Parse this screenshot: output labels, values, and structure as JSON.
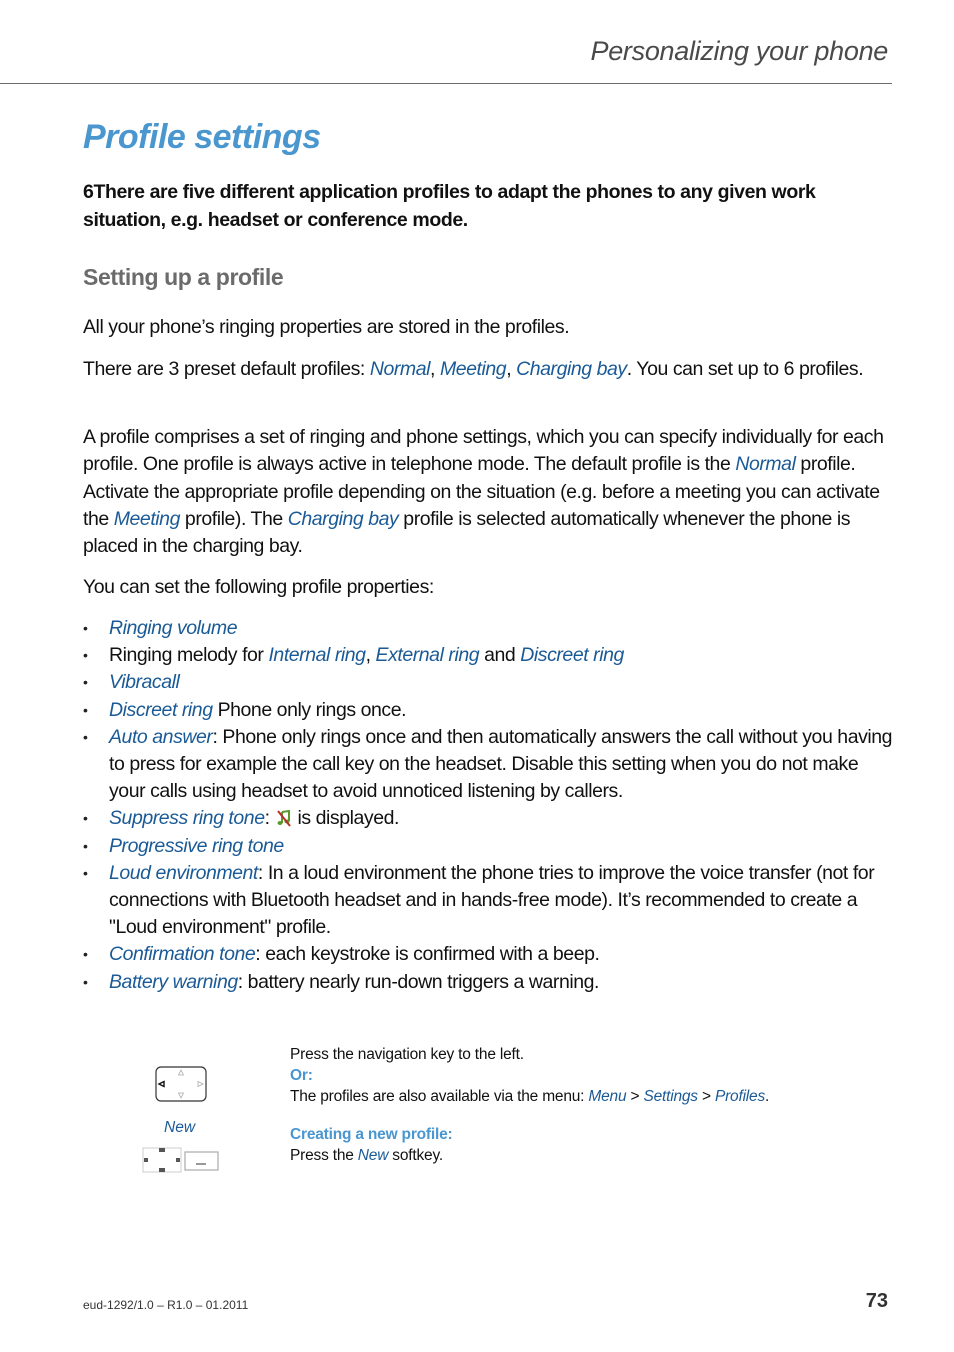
{
  "header": {
    "chapter_title": "Personalizing your phone"
  },
  "page": {
    "title": "Profile settings",
    "intro": "6There are five different application profiles to adapt the phones to any given work situation, e.g. headset or conference mode.",
    "section_title": "Setting up a profile",
    "p1": "All your phone’s ringing properties are stored in the profiles.",
    "p2": {
      "t1": "There are 3 preset default profiles: ",
      "r1": "Normal",
      "t2": ", ",
      "r2": "Meeting",
      "t3": ", ",
      "r3": "Charging bay",
      "t4": ". You can set up to 6 profiles."
    },
    "p3": {
      "t1": "A profile comprises a set of ringing and phone settings, which you can specify individ­ually for each profile. One profile is always active in telephone mode. The default pro­file is the ",
      "r1": "Normal",
      "t2": " profile. Activate the appropriate profile depending on the situation (e.g. before a meeting you can activate the ",
      "r2": "Meeting",
      "t3": " profile). The ",
      "r3": "Charging bay",
      "t4": " profile is selected automatically whenever the phone is placed in the charging bay."
    },
    "p4": "You can set the following profile properties:",
    "bullet_char": "•",
    "properties": [
      {
        "ref": "Ringing volume"
      },
      {
        "t1": "Ringing melody for ",
        "r1": "Internal ring",
        "t2": ", ",
        "r2": "External ring",
        "t3": " and ",
        "r3": "Discreet ring"
      },
      {
        "ref": "Vibracall"
      },
      {
        "ref": "Discreet ring",
        "text": " Phone only rings once."
      },
      {
        "ref": "Auto answer",
        "text": ": Phone only rings once and then automatically answers the call with­out you having to press for example the call key on the headset. Disable this setting when you do not make your calls using headset to avoid unnoticed listening by callers."
      },
      {
        "ref": "Suppress ring tone",
        "sep": ": ",
        "icon": "ringtone-off-icon",
        "text": " is displayed."
      },
      {
        "ref": "Progressive ring tone"
      },
      {
        "ref": "Loud environment",
        "text": ": In a loud environment the phone tries to improve the voice transfer (not for connections with Bluetooth headset and in hands-free mode). It’s recommended to create a \"Loud environment\" profile."
      },
      {
        "ref": "Confirmation tone",
        "text": ": each keystroke is confirmed with a beep."
      },
      {
        "ref": "Battery warning",
        "text": ": battery nearly run-down triggers a warning."
      }
    ]
  },
  "instructions": {
    "step1": {
      "icon": "navigation-key-left-icon",
      "text": "Press the navigation key to the left.",
      "or_label": "Or:",
      "menu_text": "The profiles are also available via the menu: ",
      "menu_path": [
        "Menu",
        "Settings",
        "Profiles"
      ],
      "separator": " > ",
      "end": "."
    },
    "step2": {
      "softkey_label": "New",
      "icon": "softkey-icon",
      "heading": "Creating a new profile:",
      "t1": "Press the ",
      "ref": "New",
      "t2": " softkey."
    }
  },
  "footer": {
    "doc_id": "eud-1292/1.0 – R1.0 – 01.2011",
    "page_number": "73"
  },
  "colors": {
    "title_blue": "#4a96cf",
    "reference_blue": "#1a5a96",
    "section_gray": "#6b6b6b"
  }
}
